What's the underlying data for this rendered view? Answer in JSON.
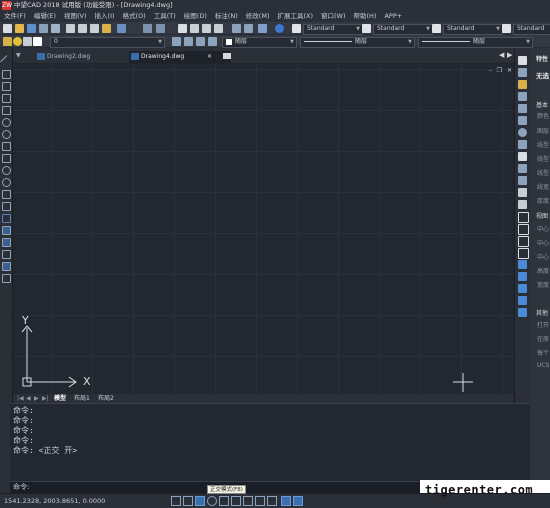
{
  "window": {
    "title": "中望CAD 2018 试用版 (功能受限) - [Drawing4.dwg]",
    "app_icon": "ZW"
  },
  "menu": [
    "文件(F)",
    "编辑(E)",
    "视图(V)",
    "插入(I)",
    "格式(O)",
    "工具(T)",
    "绘图(D)",
    "标注(N)",
    "修改(M)",
    "扩展工具(X)",
    "窗口(W)",
    "帮助(H)",
    "APP+"
  ],
  "toolbar1": {
    "text_style": "Standard",
    "dim_style": "Standard",
    "table_style": "Standard",
    "multileader_style": "Standard"
  },
  "toolbar2": {
    "layer": "0",
    "color": "随层",
    "linetype": "随层",
    "lineweight": "随层"
  },
  "doc_tabs": [
    {
      "label": "Drawing2.dwg"
    },
    {
      "label": "Drawing4.dwg"
    }
  ],
  "ucs": {
    "x_label": "X",
    "y_label": "Y"
  },
  "layout_tabs": {
    "model": "模型",
    "layout1": "布局1",
    "layout2": "布局2"
  },
  "command_history": [
    "命令:",
    "命令:",
    "命令:",
    "命令:",
    "命令: <正交 开>"
  ],
  "command_prompt": "命令:",
  "status": {
    "coords": "1541.2328, 2003.8651, 0.0000",
    "tooltip": "正交模式(F8)"
  },
  "watermark": "tigerenter.com",
  "properties": {
    "title": "特性",
    "selection": "无选",
    "sections": [
      {
        "title": "基本",
        "rows": [
          "颜色",
          "图层",
          "线型",
          "线型",
          "线型",
          "线宽",
          "厚度"
        ]
      },
      {
        "title": "视图",
        "rows": [
          "中心",
          "中心",
          "中心",
          "高度",
          "宽度"
        ]
      },
      {
        "title": "其他",
        "rows": [
          "打开",
          "在原",
          "每个",
          "UCS"
        ]
      }
    ]
  },
  "colors": {
    "canvas": "#212830",
    "accent": "#3a6fb0"
  }
}
